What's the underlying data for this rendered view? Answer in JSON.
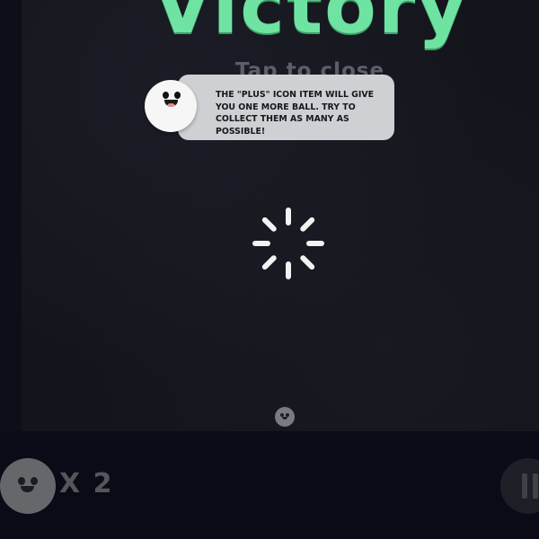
{
  "title": "Victory",
  "tap_to_close": "Tap to close",
  "tip": {
    "text": "THE \"PLUS\" ICON ITEM WILL GIVE YOU ONE MORE BALL. TRY TO COLLECT THEM AS MANY AS POSSIBLE!"
  },
  "lives": {
    "count_label": "X 2"
  },
  "icons": {
    "mascot": "smiling-ball-mascot-icon",
    "spinner": "loading-spinner-icon",
    "ball": "ball-icon",
    "lives": "lives-ball-icon",
    "pause": "pause-icon"
  },
  "colors": {
    "title": "#6fe3a1",
    "background": "#14151c",
    "tip_bubble": "#cfd0d3"
  }
}
